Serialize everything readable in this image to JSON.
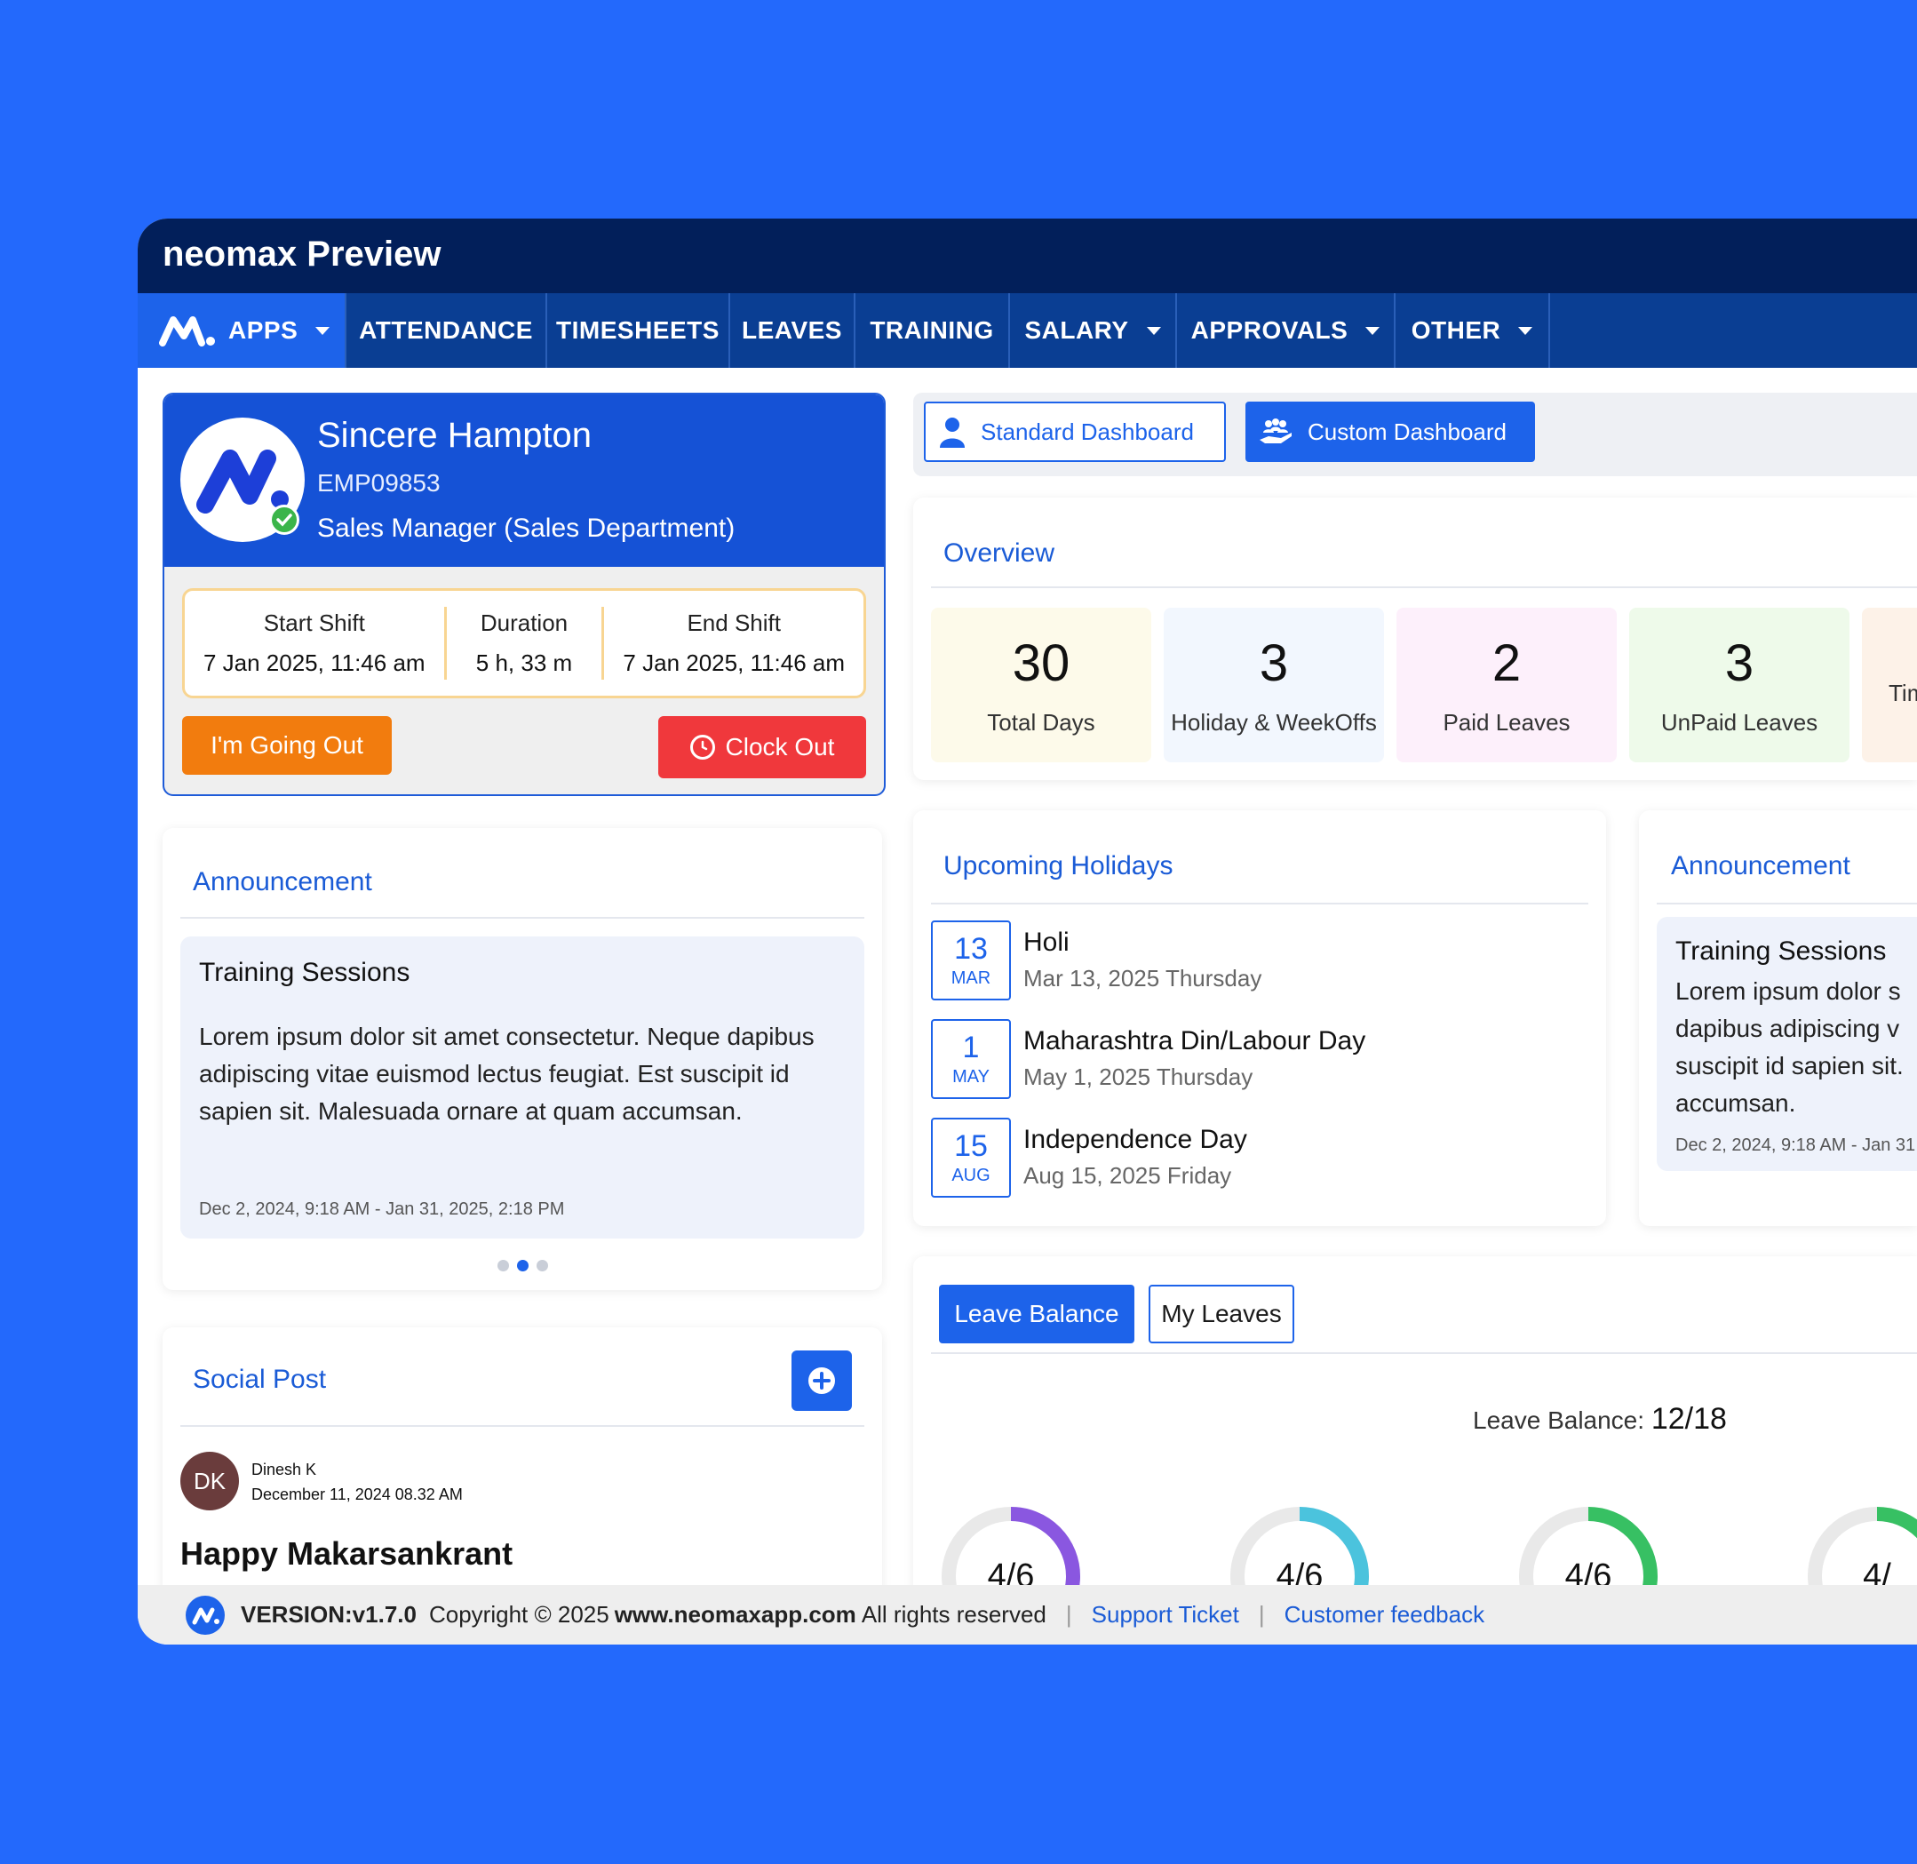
{
  "window": {
    "title": "neomax Preview"
  },
  "nav": {
    "apps": "APPS",
    "items": [
      "ATTENDANCE",
      "TIMESHEETS",
      "LEAVES",
      "TRAINING",
      "SALARY",
      "APPROVALS",
      "OTHER"
    ]
  },
  "profile": {
    "name": "Sincere Hampton",
    "emp_id": "EMP09853",
    "role": "Sales Manager (Sales Department)",
    "start_label": "Start Shift",
    "start_value": "7 Jan 2025, 11:46 am",
    "duration_label": "Duration",
    "duration_value": "5 h, 33 m",
    "end_label": "End Shift",
    "end_value": "7 Jan 2025, 11:46 am",
    "going_out": "I'm Going Out",
    "clock_out": "Clock Out"
  },
  "announcement_left": {
    "title": "Announcement",
    "item_title": "Training Sessions",
    "body": "Lorem ipsum dolor sit amet consectetur. Neque dapibus adipiscing vitae euismod lectus feugiat. Est suscipit id sapien sit. Malesuada ornare at quam accumsan.",
    "date": "Dec 2, 2024, 9:18 AM - Jan 31, 2025, 2:18 PM"
  },
  "social": {
    "title": "Social Post",
    "initials": "DK",
    "author": "Dinesh K",
    "time": "December 11, 2024 08.32 AM",
    "post_title": "Happy Makarsankrant"
  },
  "dashboards": {
    "standard": "Standard Dashboard",
    "custom": "Custom Dashboard"
  },
  "overview": {
    "title": "Overview",
    "stats": [
      {
        "value": "30",
        "label": "Total Days",
        "bg": "#fdfaea"
      },
      {
        "value": "3",
        "label": "Holiday & WeekOffs",
        "bg": "#f2f7fe"
      },
      {
        "value": "2",
        "label": "Paid Leaves",
        "bg": "#fdf0fb"
      },
      {
        "value": "3",
        "label": "UnPaid Leaves",
        "bg": "#eefaea"
      },
      {
        "value": "",
        "label": "Tim",
        "bg": "#fdf2e8"
      }
    ]
  },
  "holidays": {
    "title": "Upcoming Holidays",
    "items": [
      {
        "day": "13",
        "month": "MAR",
        "name": "Holi",
        "date": "Mar 13, 2025 Thursday"
      },
      {
        "day": "1",
        "month": "MAY",
        "name": "Maharashtra Din/Labour Day",
        "date": "May 1, 2025 Thursday"
      },
      {
        "day": "15",
        "month": "AUG",
        "name": "Independence Day",
        "date": "Aug 15, 2025 Friday"
      }
    ]
  },
  "announcement_right": {
    "title": "Announcement",
    "item_title": "Training Sessions",
    "line1": "Lorem ipsum dolor s",
    "line2": "dapibus adipiscing v",
    "line3": "suscipit id sapien sit.",
    "line4": "accumsan.",
    "date": "Dec 2, 2024, 9:18 AM - Jan 31"
  },
  "leave": {
    "tab_balance": "Leave Balance",
    "tab_my": "My Leaves",
    "balance_label": "Leave Balance:",
    "balance_value": "12/18",
    "rings": [
      {
        "text": "4/6",
        "fraction": 0.667,
        "color": "#8a57e0"
      },
      {
        "text": "4/6",
        "fraction": 0.667,
        "color": "#4bc3dd"
      },
      {
        "text": "4/6",
        "fraction": 0.667,
        "color": "#37c063"
      },
      {
        "text": "4/",
        "fraction": 0.667,
        "color": "#37c063"
      }
    ]
  },
  "footer": {
    "version": "VERSION:v1.7.0",
    "copyright": "Copyright © 2025",
    "site": "www.neomaxapp.com",
    "rights": "All rights reserved",
    "support": "Support Ticket",
    "feedback": "Customer feedback"
  }
}
